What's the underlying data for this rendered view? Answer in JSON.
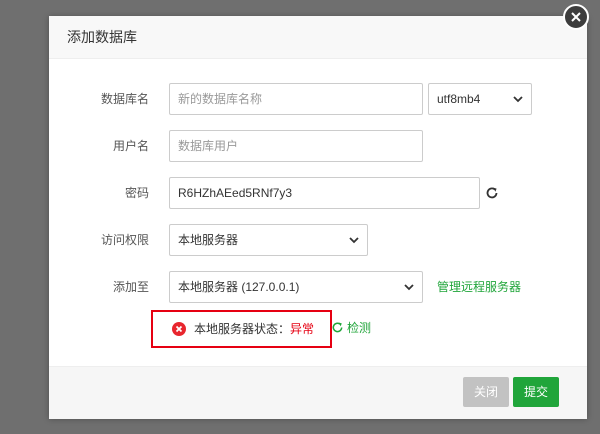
{
  "dialog": {
    "title": "添加数据库"
  },
  "form": {
    "db_name": {
      "label": "数据库名",
      "placeholder": "新的数据库名称",
      "charset": "utf8mb4"
    },
    "username": {
      "label": "用户名",
      "placeholder": "数据库用户"
    },
    "password": {
      "label": "密码",
      "value": "R6HZhAEed5RNf7y3"
    },
    "access": {
      "label": "访问权限",
      "value": "本地服务器"
    },
    "add_to": {
      "label": "添加至",
      "value": "本地服务器 (127.0.0.1)",
      "manage_link": "管理远程服务器"
    }
  },
  "status": {
    "prefix": "本地服务器状态：",
    "state": "异常",
    "detect_label": "检测"
  },
  "footer": {
    "close_label": "关闭",
    "submit_label": "提交"
  },
  "colors": {
    "accent": "#20a53a",
    "error": "#e60012",
    "overlay": "#6f6f6f"
  },
  "icons": [
    "close-icon",
    "chevron-down-icon",
    "refresh-icon",
    "error-icon"
  ]
}
